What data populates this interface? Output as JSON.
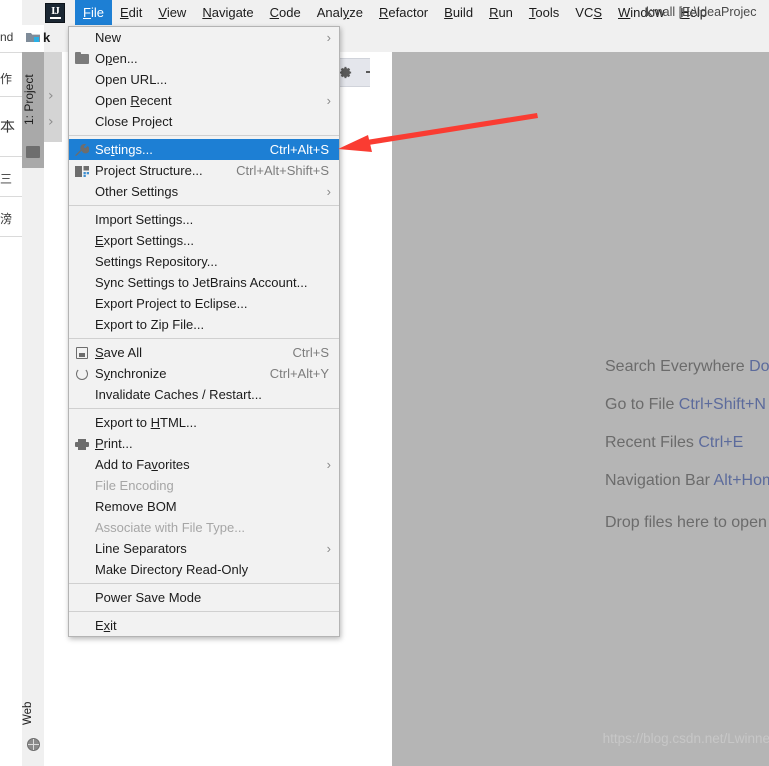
{
  "window": {
    "title": "kmall [E:\\ideaProjec",
    "app_logo": "intellij-idea-logo"
  },
  "menubar": {
    "items": [
      {
        "label": "File",
        "active": true
      },
      {
        "label": "Edit",
        "active": false
      },
      {
        "label": "View",
        "active": false
      },
      {
        "label": "Navigate",
        "active": false
      },
      {
        "label": "Code",
        "active": false
      },
      {
        "label": "Analyze",
        "active": false
      },
      {
        "label": "Refactor",
        "active": false
      },
      {
        "label": "Build",
        "active": false
      },
      {
        "label": "Run",
        "active": false
      },
      {
        "label": "Tools",
        "active": false
      },
      {
        "label": "VCS",
        "active": false
      },
      {
        "label": "Window",
        "active": false
      },
      {
        "label": "Help",
        "active": false
      }
    ]
  },
  "tool_tabs": {
    "project_tab": "1: Project",
    "web_tab": "Web",
    "project_panel_title": "k"
  },
  "file_menu": {
    "groups": [
      [
        {
          "label": "New",
          "icon": null,
          "shortcut": null,
          "submenu": true,
          "disabled": false,
          "selected": false
        },
        {
          "label": "Open...",
          "icon": "folder-icon",
          "shortcut": null,
          "submenu": false,
          "disabled": false,
          "selected": false
        },
        {
          "label": "Open URL...",
          "icon": null,
          "shortcut": null,
          "submenu": false,
          "disabled": false,
          "selected": false
        },
        {
          "label": "Open Recent",
          "icon": null,
          "shortcut": null,
          "submenu": true,
          "disabled": false,
          "selected": false
        },
        {
          "label": "Close Project",
          "icon": null,
          "shortcut": null,
          "submenu": false,
          "disabled": false,
          "selected": false
        }
      ],
      [
        {
          "label": "Settings...",
          "icon": "wrench-icon",
          "shortcut": "Ctrl+Alt+S",
          "submenu": false,
          "disabled": false,
          "selected": true
        },
        {
          "label": "Project Structure...",
          "icon": "module-icon",
          "shortcut": "Ctrl+Alt+Shift+S",
          "submenu": false,
          "disabled": false,
          "selected": false
        },
        {
          "label": "Other Settings",
          "icon": null,
          "shortcut": null,
          "submenu": true,
          "disabled": false,
          "selected": false
        }
      ],
      [
        {
          "label": "Import Settings...",
          "icon": null,
          "shortcut": null,
          "submenu": false,
          "disabled": false,
          "selected": false
        },
        {
          "label": "Export Settings...",
          "icon": null,
          "shortcut": null,
          "submenu": false,
          "disabled": false,
          "selected": false
        },
        {
          "label": "Settings Repository...",
          "icon": null,
          "shortcut": null,
          "submenu": false,
          "disabled": false,
          "selected": false
        },
        {
          "label": "Sync Settings to JetBrains Account...",
          "icon": null,
          "shortcut": null,
          "submenu": false,
          "disabled": false,
          "selected": false
        },
        {
          "label": "Export Project to Eclipse...",
          "icon": null,
          "shortcut": null,
          "submenu": false,
          "disabled": false,
          "selected": false
        },
        {
          "label": "Export to Zip File...",
          "icon": null,
          "shortcut": null,
          "submenu": false,
          "disabled": false,
          "selected": false
        }
      ],
      [
        {
          "label": "Save All",
          "icon": "save-icon",
          "shortcut": "Ctrl+S",
          "submenu": false,
          "disabled": false,
          "selected": false
        },
        {
          "label": "Synchronize",
          "icon": "sync-icon",
          "shortcut": "Ctrl+Alt+Y",
          "submenu": false,
          "disabled": false,
          "selected": false
        },
        {
          "label": "Invalidate Caches / Restart...",
          "icon": null,
          "shortcut": null,
          "submenu": false,
          "disabled": false,
          "selected": false
        }
      ],
      [
        {
          "label": "Export to HTML...",
          "icon": null,
          "shortcut": null,
          "submenu": false,
          "disabled": false,
          "selected": false
        },
        {
          "label": "Print...",
          "icon": "print-icon",
          "shortcut": null,
          "submenu": false,
          "disabled": false,
          "selected": false
        },
        {
          "label": "Add to Favorites",
          "icon": null,
          "shortcut": null,
          "submenu": true,
          "disabled": false,
          "selected": false
        },
        {
          "label": "File Encoding",
          "icon": null,
          "shortcut": null,
          "submenu": false,
          "disabled": true,
          "selected": false
        },
        {
          "label": "Remove BOM",
          "icon": null,
          "shortcut": null,
          "submenu": false,
          "disabled": false,
          "selected": false
        },
        {
          "label": "Associate with File Type...",
          "icon": null,
          "shortcut": null,
          "submenu": false,
          "disabled": true,
          "selected": false
        },
        {
          "label": "Line Separators",
          "icon": null,
          "shortcut": null,
          "submenu": true,
          "disabled": false,
          "selected": false
        },
        {
          "label": "Make Directory Read-Only",
          "icon": null,
          "shortcut": null,
          "submenu": false,
          "disabled": false,
          "selected": false
        }
      ],
      [
        {
          "label": "Power Save Mode",
          "icon": null,
          "shortcut": null,
          "submenu": false,
          "disabled": false,
          "selected": false
        }
      ],
      [
        {
          "label": "Exit",
          "icon": null,
          "shortcut": null,
          "submenu": false,
          "disabled": false,
          "selected": false
        }
      ]
    ]
  },
  "editor_hints": [
    {
      "label": "Search Everywhere",
      "key": "Doub"
    },
    {
      "label": "Go to File",
      "key": "Ctrl+Shift+N"
    },
    {
      "label": "Recent Files",
      "key": "Ctrl+E"
    },
    {
      "label": "Navigation Bar",
      "key": "Alt+Hom"
    },
    {
      "label": "Drop files here to open",
      "key": ""
    }
  ],
  "background_window_text": [
    "nd",
    "作",
    "本",
    "三",
    "滂"
  ],
  "watermark": "https://blog.csdn.net/LwinnerG",
  "colors": {
    "accent_blue": "#1d7fd4",
    "menu_bg": "#f2f2f2",
    "editor_bg": "#b5b5b5",
    "annotation_red": "#fa3c32",
    "hint_key": "#5c6b9c"
  },
  "annotation": {
    "type": "arrow",
    "points_to": "Settings...",
    "color": "#fa3c32"
  }
}
